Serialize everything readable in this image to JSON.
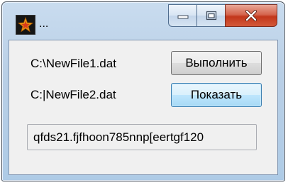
{
  "window": {
    "title": "...",
    "icon": "star-app-icon",
    "buttons": [
      "minimize-icon",
      "maximize-icon",
      "close-icon"
    ]
  },
  "form": {
    "file1_label": "C:\\NewFile1.dat",
    "file2_label": "C:|NewFile2.dat",
    "execute_button": "Выполнить",
    "show_button": "Показать",
    "output_text": "qfds21.fjfhoon785nnp[eertgf120"
  },
  "colors": {
    "close_button": "#c2371b",
    "focus_border": "#3c7fb1"
  }
}
